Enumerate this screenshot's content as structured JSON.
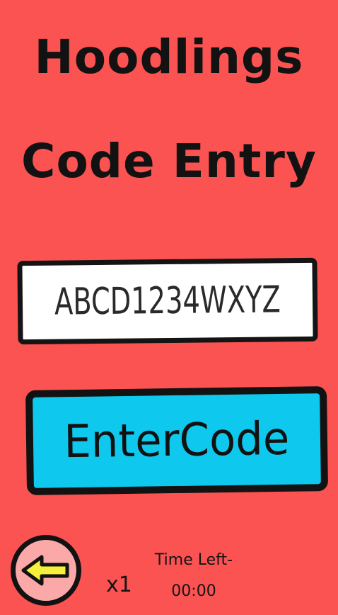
{
  "title": {
    "line1": "Hoodlings",
    "line2": "Code Entry"
  },
  "code_input": {
    "value": "ABCD1234WXYZ"
  },
  "enter_button": {
    "label": "EnterCode"
  },
  "footer": {
    "back_icon": "arrow-left-icon",
    "multiplier": "x1",
    "time_label": "Time Left-",
    "time_value": "00:00"
  },
  "colors": {
    "background": "#fb5252",
    "button": "#0ec8ee",
    "back_circle": "#fba8a8",
    "arrow": "#f5f03a"
  }
}
